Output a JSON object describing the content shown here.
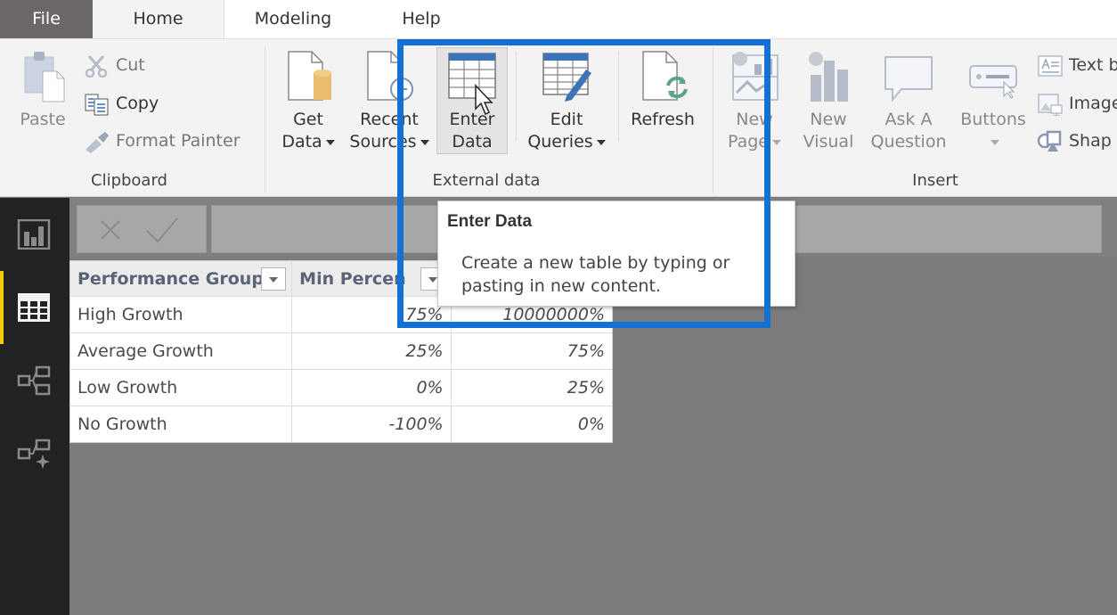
{
  "ribbon_tabs": [
    {
      "label": "File",
      "active": false
    },
    {
      "label": "Home",
      "active": true
    },
    {
      "label": "Modeling",
      "active": false
    },
    {
      "label": "Help",
      "active": false
    }
  ],
  "clipboard": {
    "group_label": "Clipboard",
    "paste": {
      "label": "Paste",
      "icon": "paste-icon",
      "enabled": false
    },
    "cut": {
      "label": "Cut",
      "icon": "scissors-icon",
      "enabled": false
    },
    "copy": {
      "label": "Copy",
      "icon": "copy-icon",
      "enabled": true
    },
    "format_painter": {
      "label": "Format Painter",
      "icon": "paintbrush-icon",
      "enabled": false
    }
  },
  "external_data": {
    "group_label": "External data",
    "get_data": {
      "line1": "Get",
      "line2": "Data",
      "icon": "database-icon",
      "has_dropdown": true
    },
    "recent_sources": {
      "line1": "Recent",
      "line2": "Sources",
      "icon": "recent-sources-icon",
      "has_dropdown": true
    },
    "enter_data": {
      "line1": "Enter",
      "line2": "Data",
      "icon": "table-icon",
      "hovered": true
    },
    "edit_queries": {
      "line1": "Edit",
      "line2": "Queries",
      "icon": "edit-table-icon",
      "has_dropdown": true
    },
    "refresh": {
      "line1": "Refresh",
      "icon": "refresh-icon"
    }
  },
  "insert": {
    "group_label": "Insert",
    "new_page": {
      "line1": "New",
      "line2": "Page",
      "icon": "new-page-icon",
      "has_dropdown": true,
      "enabled": false
    },
    "new_visual": {
      "line1": "New",
      "line2": "Visual",
      "icon": "bar-chart-icon",
      "enabled": false
    },
    "ask_question": {
      "line1": "Ask A",
      "line2": "Question",
      "icon": "speech-bubble-icon",
      "enabled": false
    },
    "buttons": {
      "line1": "Buttons",
      "icon": "button-icon",
      "has_dropdown": true,
      "enabled": false
    },
    "text_box": {
      "label": "Text b",
      "icon": "text-box-icon"
    },
    "image": {
      "label": "Image",
      "icon": "image-icon"
    },
    "shapes": {
      "label": "Shap",
      "icon": "shapes-icon"
    }
  },
  "left_nav": [
    {
      "name": "report-view",
      "icon": "report-icon",
      "active": false
    },
    {
      "name": "data-view",
      "icon": "table-grid-icon",
      "active": true
    },
    {
      "name": "relationships-view",
      "icon": "relationships-icon",
      "active": false
    },
    {
      "name": "model-view",
      "icon": "model-sparkle-icon",
      "active": false
    }
  ],
  "formula_bar": {
    "cancel_icon": "x-icon",
    "commit_icon": "checkmark-icon",
    "value": ""
  },
  "table": {
    "columns": [
      "Performance Group",
      "Min Percen",
      ""
    ],
    "rows": [
      [
        "High Growth",
        "75%",
        "10000000%"
      ],
      [
        "Average Growth",
        "25%",
        "75%"
      ],
      [
        "Low Growth",
        "0%",
        "25%"
      ],
      [
        "No Growth",
        "-100%",
        "0%"
      ]
    ]
  },
  "tooltip": {
    "title": "Enter Data",
    "body": "Create a new table by typing or pasting in new content."
  },
  "colors": {
    "highlight_box": "#1570d4",
    "nav_accent": "#f2c80f",
    "nav_bg": "#222224",
    "canvas_bg": "#7b7b7d"
  }
}
